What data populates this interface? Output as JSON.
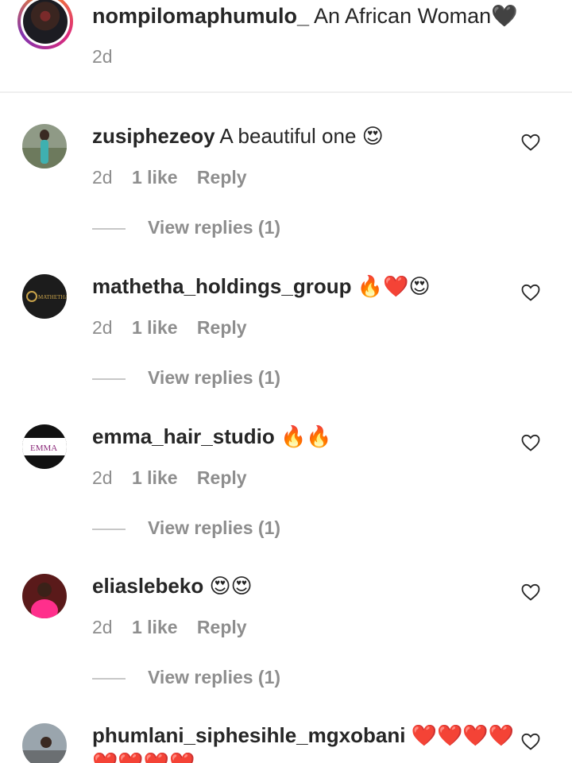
{
  "caption": {
    "username": "nompilomaphumulo_",
    "text": "An African Woman",
    "emoji": "🖤",
    "time": "2d"
  },
  "comments": [
    {
      "username": "zusiphezeoy",
      "text": "A beautiful one",
      "emoji": "😍",
      "time": "2d",
      "likes": "1 like",
      "reply_label": "Reply",
      "replies_label": "View replies (1)"
    },
    {
      "username": "mathetha_holdings_group",
      "text": "",
      "emoji": "🔥❤️😍",
      "time": "2d",
      "likes": "1 like",
      "reply_label": "Reply",
      "replies_label": "View replies (1)",
      "avatar_text": "MATHETHA"
    },
    {
      "username": "emma_hair_studio",
      "text": "",
      "emoji": "🔥🔥",
      "time": "2d",
      "likes": "1 like",
      "reply_label": "Reply",
      "replies_label": "View replies (1)",
      "avatar_text": "EMMA"
    },
    {
      "username": "eliaslebeko",
      "text": "",
      "emoji": "😍😍",
      "time": "2d",
      "likes": "1 like",
      "reply_label": "Reply",
      "replies_label": "View replies (1)"
    },
    {
      "username": "phumlani_siphesihle_mgxobani",
      "text": "",
      "emoji": "❤️❤️❤️❤️",
      "emoji_overflow": "❤️❤️❤️❤️"
    }
  ],
  "icons": {
    "like": "heart-outline-icon"
  },
  "colors": {
    "muted": "#8e8e8e",
    "text": "#262626",
    "story_ring": "#dd2a7b",
    "heart_red": "#ed4956"
  }
}
